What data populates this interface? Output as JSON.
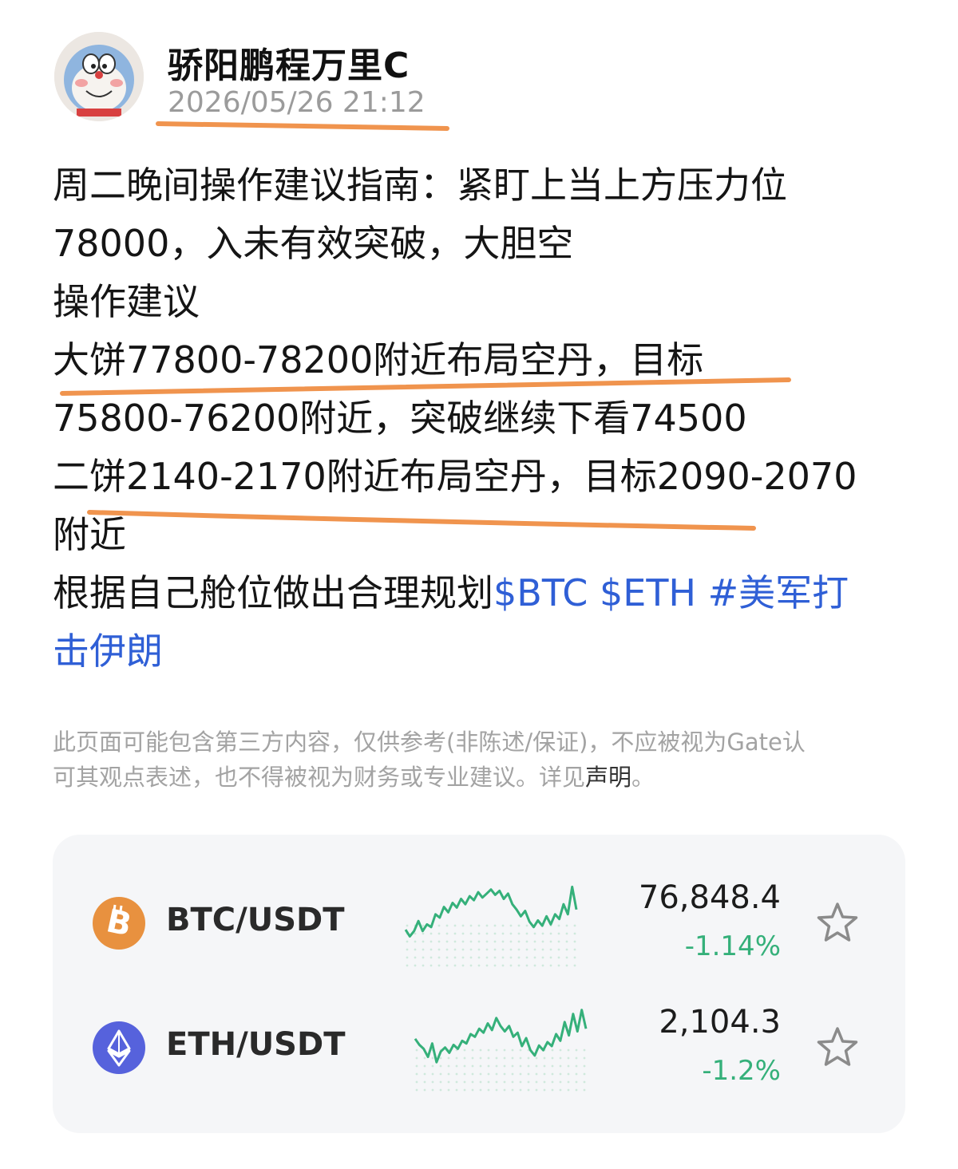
{
  "post": {
    "author": "骄阳鹏程万里C",
    "timestamp": "2026/05/26 21:12",
    "lines": [
      "周二晚间操作建议指南：紧盯上当上方压力位",
      "78000，入未有效突破，大胆空",
      "操作建议",
      "大饼77800-78200附近布局空丹，目标",
      "75800-76200附近，突破继续下看74500",
      "二饼2140-2170附近布局空丹，目标2090-2070",
      "附近"
    ],
    "closing_text": "根据自己舱位做出合理规划",
    "tags": [
      "$BTC",
      "$ETH",
      "#美军打",
      "击伊朗"
    ]
  },
  "disclaimer": {
    "line1": "此页面可能包含第三方内容，仅供参考(非陈述/保证)，不应被视为Gate认",
    "line2_prefix": "可其观点表述，也不得被视为财务或专业建议。详见",
    "link": "声明",
    "line2_suffix": "。"
  },
  "markets": [
    {
      "pair": "BTC/USDT",
      "icon": "bitcoin-icon",
      "icon_color": "#e8913f",
      "price": "76,848.4",
      "change": "-1.14%",
      "change_color": "#35b07a",
      "sparkline": [
        0.32,
        0.22,
        0.3,
        0.45,
        0.3,
        0.4,
        0.36,
        0.55,
        0.5,
        0.66,
        0.58,
        0.72,
        0.65,
        0.78,
        0.7,
        0.82,
        0.76,
        0.88,
        0.8,
        0.86,
        0.92,
        0.84,
        0.9,
        0.78,
        0.86,
        0.7,
        0.62,
        0.52,
        0.6,
        0.44,
        0.36,
        0.46,
        0.38,
        0.52,
        0.4,
        0.55,
        0.48,
        0.7,
        0.55,
        0.96,
        0.62
      ]
    },
    {
      "pair": "ETH/USDT",
      "icon": "ethereum-icon",
      "icon_color": "#5662dc",
      "price": "2,104.3",
      "change": "-1.2%",
      "change_color": "#35b07a",
      "sparkline": [
        0.55,
        0.46,
        0.4,
        0.28,
        0.48,
        0.2,
        0.36,
        0.42,
        0.34,
        0.46,
        0.4,
        0.52,
        0.48,
        0.62,
        0.58,
        0.7,
        0.64,
        0.78,
        0.68,
        0.86,
        0.74,
        0.66,
        0.74,
        0.58,
        0.64,
        0.44,
        0.56,
        0.38,
        0.3,
        0.45,
        0.38,
        0.5,
        0.44,
        0.62,
        0.52,
        0.8,
        0.6,
        0.92,
        0.66,
        0.98,
        0.7
      ]
    }
  ],
  "watch_icon": "star-outline-icon"
}
